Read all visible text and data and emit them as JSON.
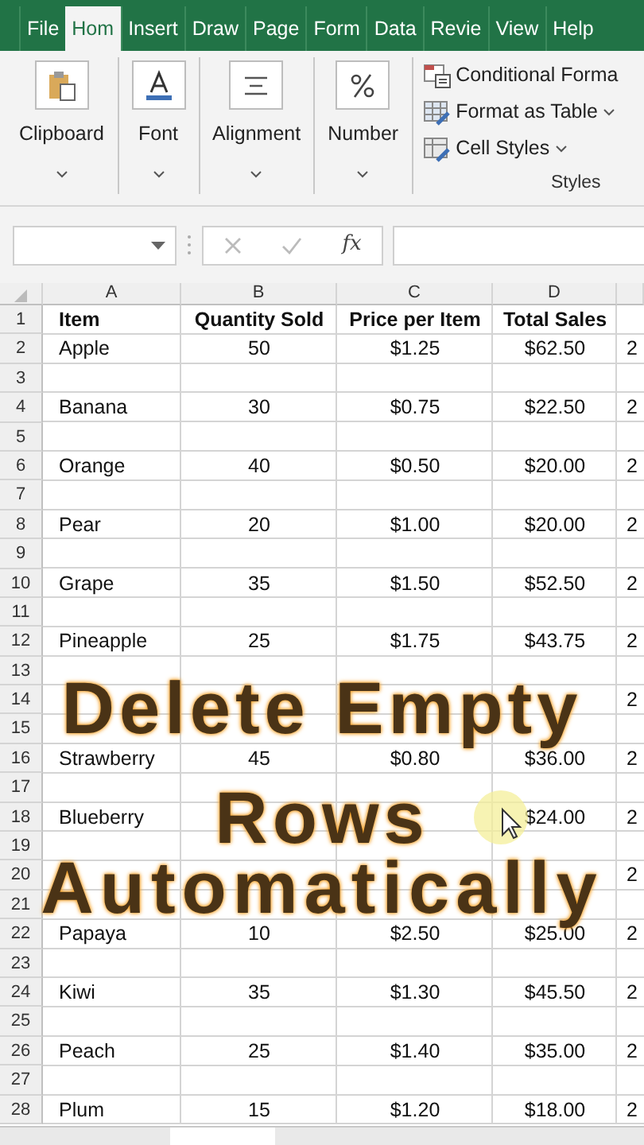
{
  "ribbon_tabs": [
    {
      "label": "File",
      "selected": false
    },
    {
      "label": "Hom",
      "selected": true
    },
    {
      "label": "Insert",
      "selected": false
    },
    {
      "label": "Draw",
      "selected": false
    },
    {
      "label": "Page",
      "selected": false
    },
    {
      "label": "Form",
      "selected": false
    },
    {
      "label": "Data",
      "selected": false
    },
    {
      "label": "Revie",
      "selected": false
    },
    {
      "label": "View",
      "selected": false
    },
    {
      "label": "Help",
      "selected": false
    }
  ],
  "ribbon_groups": [
    {
      "label": "Clipboard",
      "kind": "clipboard"
    },
    {
      "label": "Font",
      "kind": "font"
    },
    {
      "label": "Alignment",
      "kind": "alignment"
    },
    {
      "label": "Number",
      "kind": "number"
    }
  ],
  "styles_group": {
    "label": "Styles",
    "items": [
      {
        "label": "Conditional Forma",
        "kind": "conditional",
        "dropdown": false
      },
      {
        "label": "Format as Table",
        "kind": "table",
        "dropdown": true
      },
      {
        "label": "Cell Styles",
        "kind": "cellstyles",
        "dropdown": true
      }
    ]
  },
  "formula_bar": {
    "function_label": "fx"
  },
  "columns": [
    "A",
    "B",
    "C",
    "D"
  ],
  "rows": [
    {
      "number": "1",
      "kind": "header",
      "item": "Item",
      "quantity": "Quantity Sold",
      "price": "Price per Item",
      "total": "Total Sales"
    },
    {
      "number": "2",
      "item": "Apple",
      "quantity": "50",
      "price": "$1.25",
      "total": "$62.50",
      "column_e": "2"
    },
    {
      "number": "3"
    },
    {
      "number": "4",
      "item": "Banana",
      "quantity": "30",
      "price": "$0.75",
      "total": "$22.50",
      "column_e": "2"
    },
    {
      "number": "5"
    },
    {
      "number": "6",
      "item": "Orange",
      "quantity": "40",
      "price": "$0.50",
      "total": "$20.00",
      "column_e": "2"
    },
    {
      "number": "7"
    },
    {
      "number": "8",
      "item": "Pear",
      "quantity": "20",
      "price": "$1.00",
      "total": "$20.00",
      "column_e": "2"
    },
    {
      "number": "9"
    },
    {
      "number": "10",
      "item": "Grape",
      "quantity": "35",
      "price": "$1.50",
      "total": "$52.50",
      "column_e": "2"
    },
    {
      "number": "11"
    },
    {
      "number": "12",
      "item": "Pineapple",
      "quantity": "25",
      "price": "$1.75",
      "total": "$43.75",
      "column_e": "2"
    },
    {
      "number": "13"
    },
    {
      "number": "14",
      "column_e": "2"
    },
    {
      "number": "15"
    },
    {
      "number": "16",
      "item": "Strawberry",
      "quantity": "45",
      "price": "$0.80",
      "total": "$36.00",
      "column_e": "2"
    },
    {
      "number": "17"
    },
    {
      "number": "18",
      "item": "Blueberry",
      "total": "$24.00",
      "column_e": "2"
    },
    {
      "number": "19"
    },
    {
      "number": "20",
      "column_e": "2"
    },
    {
      "number": "21"
    },
    {
      "number": "22",
      "item": "Papaya",
      "quantity": "10",
      "price": "$2.50",
      "total": "$25.00",
      "column_e": "2"
    },
    {
      "number": "23"
    },
    {
      "number": "24",
      "item": "Kiwi",
      "quantity": "35",
      "price": "$1.30",
      "total": "$45.50",
      "column_e": "2"
    },
    {
      "number": "25"
    },
    {
      "number": "26",
      "item": "Peach",
      "quantity": "25",
      "price": "$1.40",
      "total": "$35.00",
      "column_e": "2"
    },
    {
      "number": "27"
    },
    {
      "number": "28",
      "item": "Plum",
      "quantity": "15",
      "price": "$1.20",
      "total": "$18.00",
      "column_e": "2"
    }
  ],
  "overlay_caption": [
    "Delete Empty",
    "Rows",
    "Automatically"
  ]
}
